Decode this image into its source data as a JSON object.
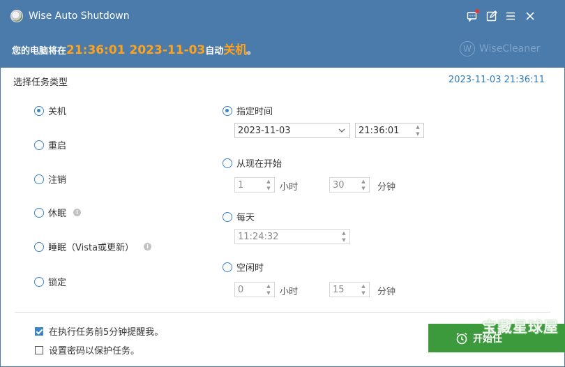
{
  "window": {
    "title": "Wise Auto Shutdown"
  },
  "banner": {
    "prefix": "您的电脑将在",
    "time": "21:36:01 2023-11-03",
    "middle": "自动",
    "action": "关机",
    "suffix": "。",
    "brand": "WiseCleaner",
    "brand_mark": "W"
  },
  "task_type": {
    "label": "选择任务类型",
    "current_datetime": "2023-11-03 21:36:11",
    "options": [
      {
        "label": "关机",
        "selected": true
      },
      {
        "label": "重启",
        "selected": false
      },
      {
        "label": "注销",
        "selected": false
      },
      {
        "label": "休眠",
        "selected": false
      },
      {
        "label": "睡眠（Vista或更新）",
        "selected": false
      },
      {
        "label": "锁定",
        "selected": false
      }
    ]
  },
  "schedule": {
    "specified": {
      "label": "指定时间",
      "selected": true,
      "date": "2023-11-03",
      "time": "21:36:01"
    },
    "from_now": {
      "label": "从现在开始",
      "selected": false,
      "hours": "1",
      "hours_unit": "小时",
      "minutes": "30",
      "minutes_unit": "分钟"
    },
    "daily": {
      "label": "每天",
      "selected": false,
      "time": "11:24:32"
    },
    "idle": {
      "label": "空闲时",
      "selected": false,
      "hours": "0",
      "hours_unit": "小时",
      "minutes": "15",
      "minutes_unit": "分钟"
    }
  },
  "footer": {
    "remind": {
      "label": "在执行任务前5分钟提醒我。",
      "checked": true
    },
    "password": {
      "label": "设置密码以保护任务。",
      "checked": false
    },
    "start_button": "开始任",
    "watermark": "宝藏星球屋"
  },
  "colors": {
    "titlebar": "#4a7bab",
    "highlight": "#ffa21a",
    "accent": "#3a83c4",
    "start_button": "#3c9a3c"
  },
  "icons": {
    "message": "message-icon",
    "feedback": "edit-icon",
    "menu": "menu-icon",
    "close": "close-icon"
  },
  "info_mark": "i"
}
